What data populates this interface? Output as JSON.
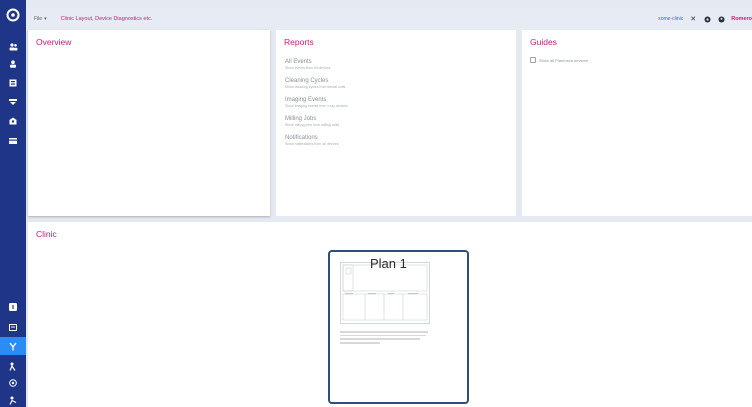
{
  "topbar": {
    "mode": "File",
    "breadcrumb": "Clinic Layout, Device Diagnostics etc.",
    "link": "some-clinic",
    "user": "Romero"
  },
  "overview": {
    "title": "Overview"
  },
  "reports": {
    "title": "Reports",
    "items": [
      {
        "title": "All Events",
        "desc": "Show events from all devices"
      },
      {
        "title": "Cleaning Cycles",
        "desc": "Show cleaning cycles from dental units"
      },
      {
        "title": "Imaging Events",
        "desc": "Show imaging events from x-ray devices"
      },
      {
        "title": "Milling Jobs",
        "desc": "Show milling jobs from milling units"
      },
      {
        "title": "Notifications",
        "desc": "Show notifications from all devices"
      }
    ]
  },
  "guides": {
    "title": "Guides",
    "toggle_label": "Show all Planmeca devices"
  },
  "clinic": {
    "title": "Clinic",
    "plan_name": "Plan 1"
  },
  "colors": {
    "sidebar": "#1f3688",
    "accent": "#c81d77",
    "active": "#2c8cf4",
    "link": "#2b6fd8"
  },
  "icons": {
    "sidebar_top": [
      "users-icon",
      "user-icon",
      "devices-icon",
      "dropdown-icon",
      "clinic-icon",
      "card-icon"
    ],
    "sidebar_bottom": [
      "help-icon",
      "message-icon",
      "tool-icon",
      "person-tool-icon",
      "info-icon",
      "service-icon"
    ],
    "topbar": [
      "close-icon",
      "settings-icon",
      "account-icon"
    ]
  }
}
